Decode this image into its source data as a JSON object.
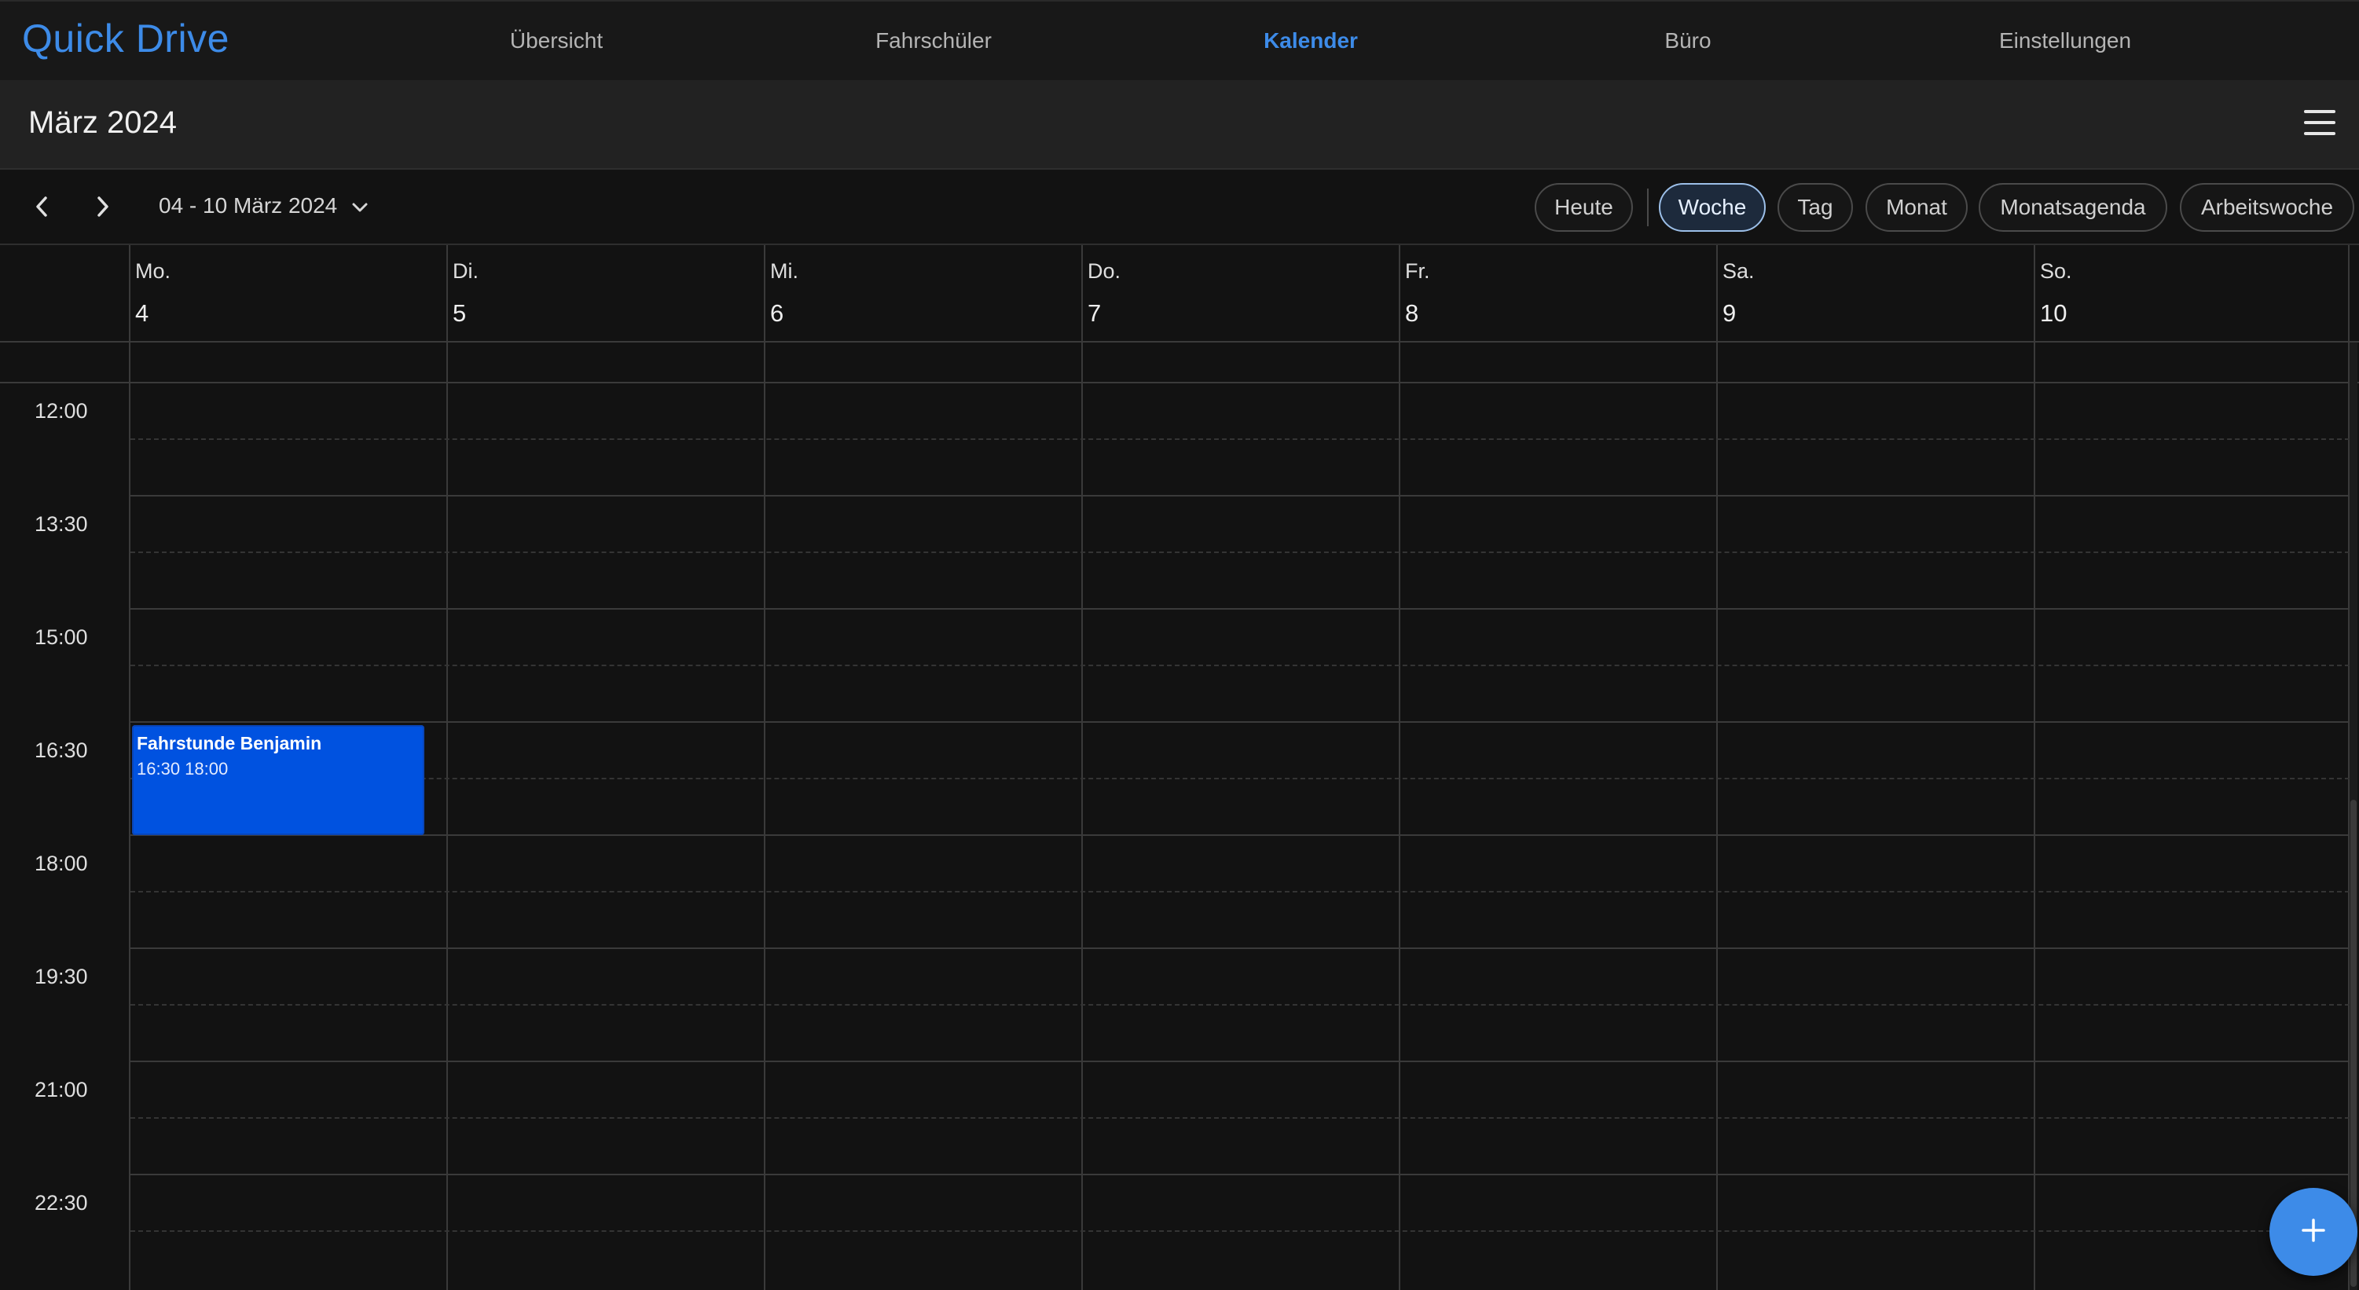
{
  "app": {
    "brand": "Quick Drive",
    "accent_color": "#3d8be8"
  },
  "nav": {
    "items": [
      {
        "label": "Übersicht",
        "active": false
      },
      {
        "label": "Fahrschüler",
        "active": false
      },
      {
        "label": "Kalender",
        "active": true
      },
      {
        "label": "Büro",
        "active": false
      },
      {
        "label": "Einstellungen",
        "active": false
      }
    ]
  },
  "header": {
    "month_title": "März 2024",
    "menu_icon": "hamburger-menu-icon"
  },
  "toolbar": {
    "prev_icon": "chevron-left-icon",
    "next_icon": "chevron-right-icon",
    "range_label": "04 - 10 März 2024",
    "range_icon": "chevron-down-icon",
    "today_label": "Heute",
    "views": [
      {
        "label": "Woche",
        "active": true
      },
      {
        "label": "Tag",
        "active": false
      },
      {
        "label": "Monat",
        "active": false
      },
      {
        "label": "Monatsagenda",
        "active": false
      },
      {
        "label": "Arbeitswoche",
        "active": false
      }
    ]
  },
  "calendar": {
    "days": [
      {
        "name": "Mo.",
        "num": "4"
      },
      {
        "name": "Di.",
        "num": "5"
      },
      {
        "name": "Mi.",
        "num": "6"
      },
      {
        "name": "Do.",
        "num": "7"
      },
      {
        "name": "Fr.",
        "num": "8"
      },
      {
        "name": "Sa.",
        "num": "9"
      },
      {
        "name": "So.",
        "num": "10"
      }
    ],
    "time_labels": [
      "12:00",
      "13:30",
      "15:00",
      "16:30",
      "18:00",
      "19:30",
      "21:00",
      "22:30"
    ],
    "events": [
      {
        "title": "Fahrstunde Benjamin",
        "time": "16:30 18:00",
        "day": "Mo.",
        "color": "#0052e0"
      }
    ]
  },
  "fab": {
    "icon": "plus-icon"
  }
}
